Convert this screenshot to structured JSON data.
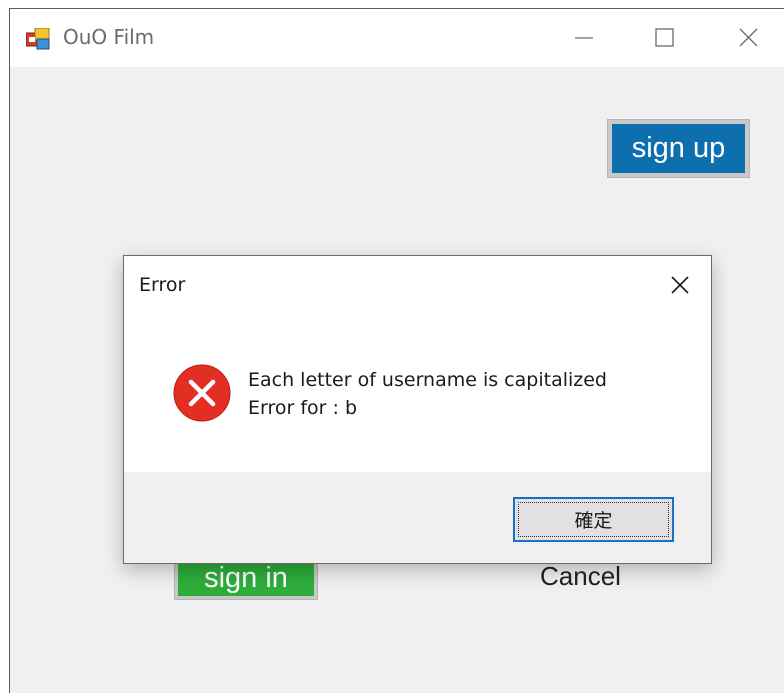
{
  "window": {
    "title": "OuO Film"
  },
  "form": {
    "signup_label": "sign up",
    "signin_label": "sign in",
    "cancel_label": "Cancel"
  },
  "dialog": {
    "title": "Error",
    "message_line1": "Each letter of username is capitalized",
    "message_line2": "Error for : b",
    "ok_label": "確定",
    "icon": "error-icon"
  },
  "colors": {
    "signup_bg": "#0e6fae",
    "signin_bg": "#2ead3a",
    "error_red": "#e32e24",
    "focus_blue": "#1a6fc6"
  }
}
